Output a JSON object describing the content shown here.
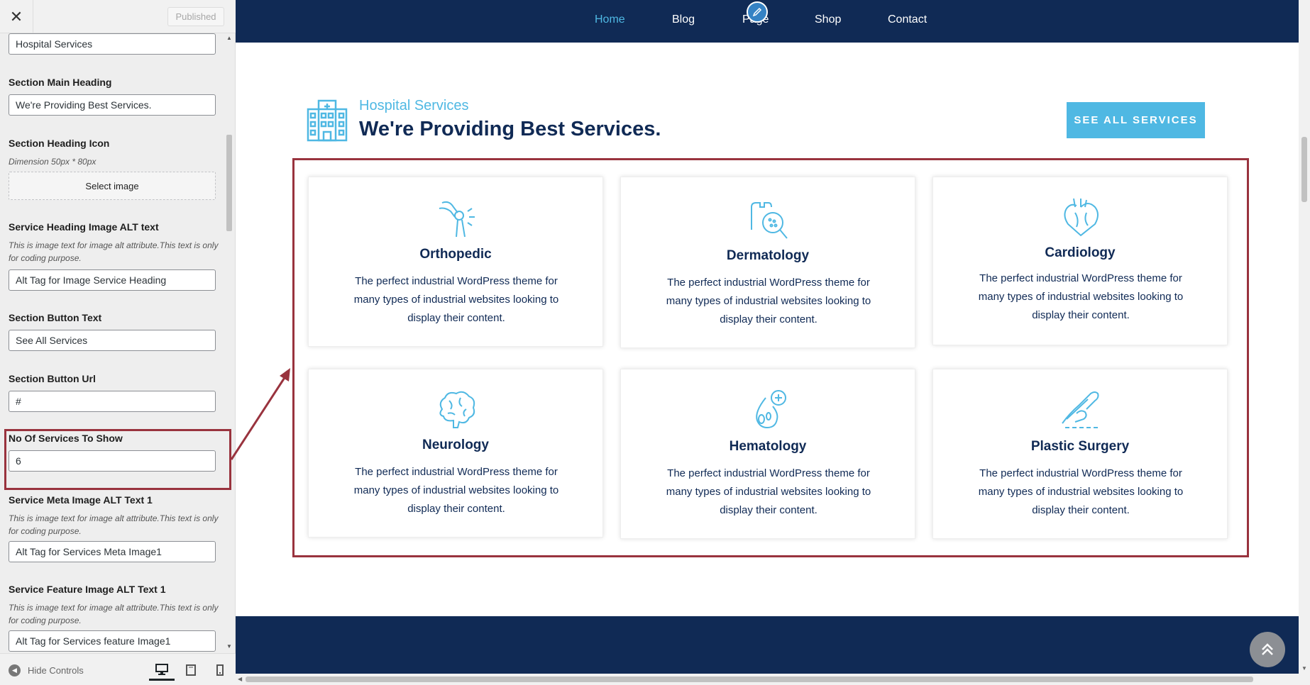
{
  "sidebar": {
    "close_symbol": "✕",
    "published_label": "Published",
    "fields": {
      "subheading_value": "Hospital Services",
      "main_heading_label": "Section Main Heading",
      "main_heading_value": "We're Providing Best Services.",
      "icon_label": "Section Heading Icon",
      "icon_desc": "Dimension 50px * 80px",
      "select_image_label": "Select image",
      "heading_alt_label": "Service Heading Image ALT text",
      "heading_alt_desc": "This is image text for image alt attribute.This text is only for coding purpose.",
      "heading_alt_value": "Alt Tag for Image Service Heading",
      "button_text_label": "Section Button Text",
      "button_text_value": "See All Services",
      "button_url_label": "Section Button Url",
      "button_url_value": "#",
      "num_services_label": "No Of Services To Show",
      "num_services_value": "6",
      "meta_alt_label": "Service Meta Image ALT Text 1",
      "meta_alt_desc": "This is image text for image alt attribute.This text is only for coding purpose.",
      "meta_alt_value": "Alt Tag for Services Meta Image1",
      "feature_alt_label": "Service Feature Image ALT Text 1",
      "feature_alt_desc": "This is image text for image alt attribute.This text is only for coding purpose.",
      "feature_alt_value": "Alt Tag for Services feature Image1"
    },
    "footer": {
      "hide_controls_label": "Hide Controls",
      "devices": [
        "desktop-icon",
        "tablet-icon",
        "mobile-icon"
      ]
    }
  },
  "preview": {
    "nav": {
      "items": [
        "Home",
        "Blog",
        "Page",
        "Shop",
        "Contact"
      ],
      "active": "Home"
    },
    "section": {
      "subheading": "Hospital Services",
      "heading": "We're Providing Best Services.",
      "button_label": "SEE ALL SERVICES"
    },
    "services": [
      {
        "title": "Orthopedic",
        "icon": "knee-joint-icon",
        "text": "The perfect industrial WordPress theme for many types of industrial websites looking to display their content."
      },
      {
        "title": "Dermatology",
        "icon": "skin-magnifier-icon",
        "text": "The perfect industrial WordPress theme for many types of industrial websites looking to display their content."
      },
      {
        "title": "Cardiology",
        "icon": "heart-organ-icon",
        "text": "The perfect industrial WordPress theme for many types of industrial websites looking to display their content."
      },
      {
        "title": "Neurology",
        "icon": "brain-icon",
        "text": "The perfect industrial WordPress theme for many types of industrial websites looking to display their content."
      },
      {
        "title": "Hematology",
        "icon": "blood-drop-icon",
        "text": "The perfect industrial WordPress theme for many types of industrial websites looking to display their content."
      },
      {
        "title": "Plastic Surgery",
        "icon": "surgery-hand-icon",
        "text": "The perfect industrial WordPress theme for many types of industrial websites looking to display their content."
      }
    ]
  },
  "colors": {
    "navy": "#102a55",
    "accent": "#4fb8e3",
    "highlight": "#99333e"
  }
}
